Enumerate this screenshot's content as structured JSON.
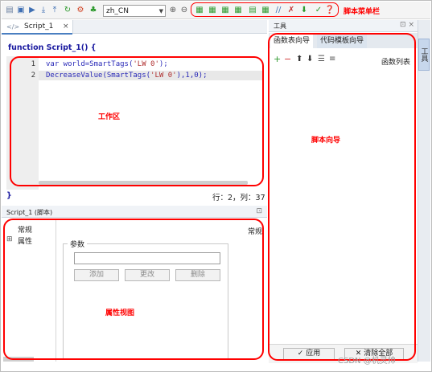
{
  "toolbar": {
    "language_value": "zh_CN",
    "icons": [
      "new-icon",
      "open-icon",
      "run-icon",
      "download-icon",
      "upload-icon",
      "refresh-icon",
      "network-icon",
      "tags-icon",
      "zoom-in-icon",
      "zoom-out-icon",
      "bookmark-icon",
      "indent-icon",
      "outdent-icon",
      "align-icon",
      "table-icon",
      "comment-icon",
      "uncomment-icon",
      "arrow-down-icon",
      "check-icon",
      "help-icon"
    ],
    "annotation": "脚本菜单栏"
  },
  "editor": {
    "tab_label": "Script_1",
    "tab_close": "×",
    "function_header": "function Script_1() {",
    "lines": [
      {
        "num": "1",
        "code_a": "var world=SmartTags(",
        "code_str": "'LW 0'",
        "code_b": ");"
      },
      {
        "num": "2",
        "code_a": "DecreaseValue(SmartTags(",
        "code_str": "'LW 0'",
        "code_b": "),1,0);"
      }
    ],
    "function_close": "}",
    "status": "行：2，列：37",
    "annotation": "工作区"
  },
  "properties": {
    "panel_title": "Script_1 (脚本)",
    "pin_icon": "⊡",
    "tree_general": "常规",
    "tree_attributes": "属性",
    "expand_glyph": "⊞",
    "section_title": "常规",
    "group_label": "参数",
    "add_button": "添加",
    "change_button": "更改",
    "delete_button": "删除",
    "annotation": "属性视图"
  },
  "tools": {
    "panel_title": "工具",
    "window_controls": "⊡ ×",
    "tab_function_list": "函数表向导",
    "tab_code_template": "代码模板向导",
    "function_list_label": "函数列表",
    "apply_button": "应用",
    "clear_all_button": "清除全部",
    "side_tab_label": "工具",
    "annotation": "脚本向导"
  },
  "watermark": "CSDN @机灵帅",
  "colors": {
    "annotation_red": "#ff0000",
    "code_blue": "#2a2ab8",
    "string_red": "#b03030",
    "tab_active_border": "#4a7fc1"
  }
}
